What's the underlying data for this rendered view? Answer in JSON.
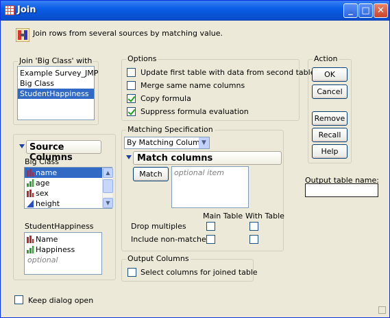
{
  "window": {
    "title": "Join",
    "header_text": "Join rows from several sources by matching value."
  },
  "join_with": {
    "label": "Join 'Big Class' with",
    "items": [
      "Example Survey_JMP",
      "Big Class",
      "StudentHappiness"
    ],
    "selected": "StudentHappiness"
  },
  "source_columns": {
    "title": "Source Columns",
    "table1_name": "Big Class",
    "table1_columns": [
      {
        "name": "name",
        "type": "nominal",
        "selected": true
      },
      {
        "name": "age",
        "type": "ordinal",
        "selected": false
      },
      {
        "name": "sex",
        "type": "nominal",
        "selected": false
      },
      {
        "name": "height",
        "type": "continuous",
        "selected": false
      }
    ],
    "table2_name": "StudentHappiness",
    "table2_columns": [
      {
        "name": "Name",
        "type": "nominal"
      },
      {
        "name": "Happiness",
        "type": "ordinal"
      }
    ],
    "table2_placeholder": "optional"
  },
  "options": {
    "label": "Options",
    "items": [
      {
        "label": "Update first table with data from second table",
        "checked": false
      },
      {
        "label": "Merge same name columns",
        "checked": false
      },
      {
        "label": "Copy formula",
        "checked": true
      },
      {
        "label": "Suppress formula evaluation",
        "checked": true
      }
    ]
  },
  "matching": {
    "label": "Matching Specification",
    "method": "By Matching Columns",
    "match_columns_title": "Match columns",
    "match_button": "Match",
    "match_placeholder": "optional item",
    "col_main": "Main Table",
    "col_with": "With Table",
    "drop_multiples": "Drop multiples",
    "include_nonmatches": "Include non-matches"
  },
  "output_columns": {
    "label": "Output Columns",
    "select_label": "Select columns for joined table",
    "checked": false
  },
  "action": {
    "label": "Action",
    "ok": "OK",
    "cancel": "Cancel",
    "remove": "Remove",
    "recall": "Recall",
    "help": "Help"
  },
  "output_table": {
    "label": "Output table name:",
    "value": ""
  },
  "footer": {
    "keep_open": "Keep dialog open",
    "checked": false
  }
}
